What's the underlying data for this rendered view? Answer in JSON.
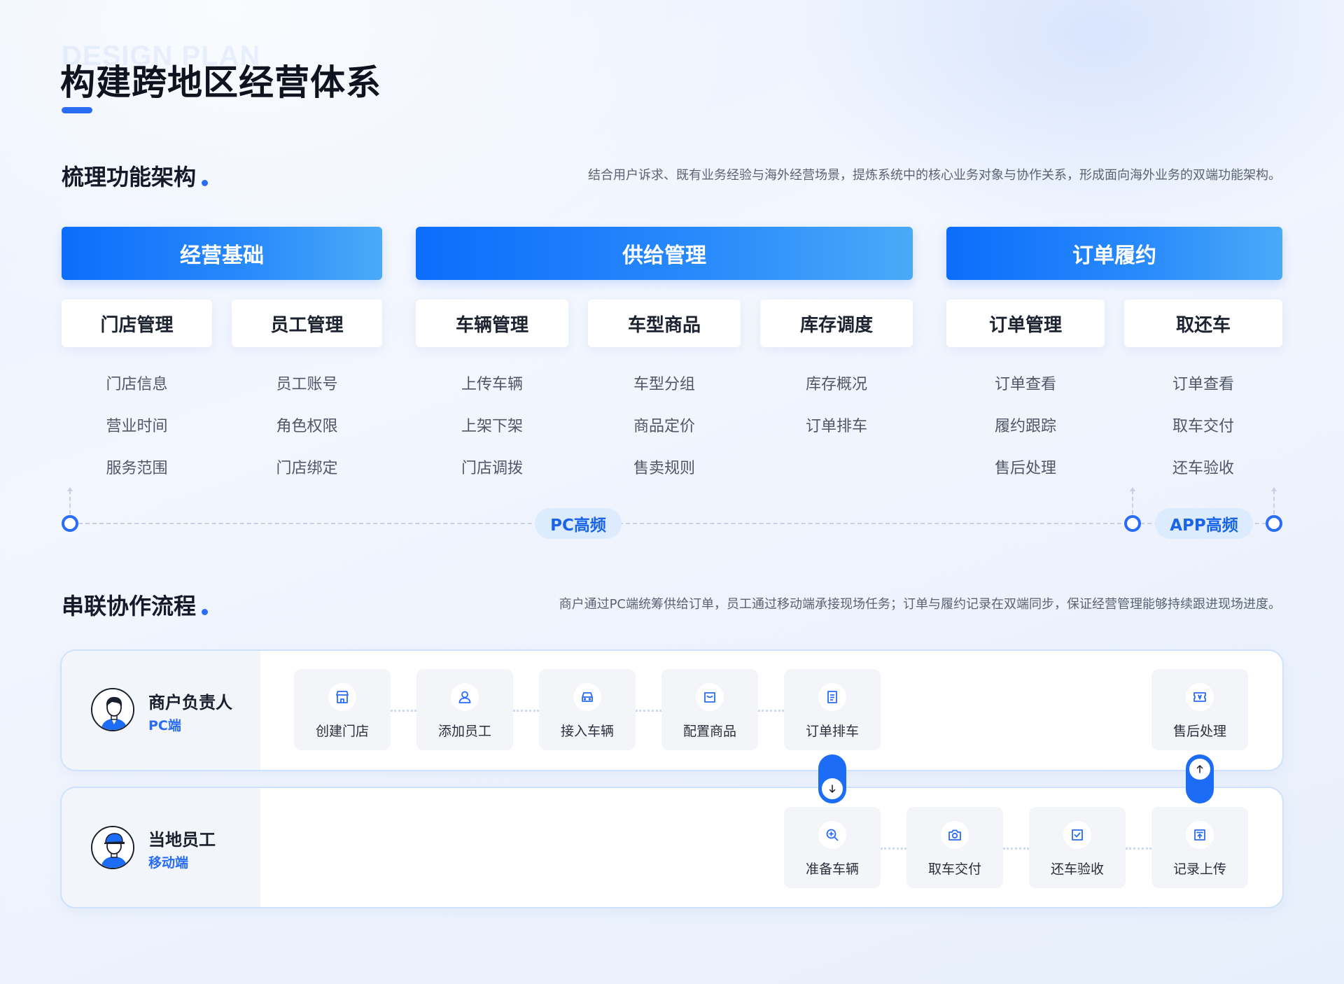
{
  "header": {
    "eyebrow": "DESIGN PLAN",
    "title": "构建跨地区经营体系"
  },
  "architecture": {
    "title": "梳理功能架构",
    "description": "结合用户诉求、既有业务经验与海外经营场景，提炼系统中的核心业务对象与协作关系，形成面向海外业务的双端功能架构。",
    "categories": [
      {
        "label": "经营基础",
        "modules": [
          {
            "label": "门店管理",
            "features": [
              "门店信息",
              "营业时间",
              "服务范围"
            ]
          },
          {
            "label": "员工管理",
            "features": [
              "员工账号",
              "角色权限",
              "门店绑定"
            ]
          }
        ]
      },
      {
        "label": "供给管理",
        "modules": [
          {
            "label": "车辆管理",
            "features": [
              "上传车辆",
              "上架下架",
              "门店调拨"
            ]
          },
          {
            "label": "车型商品",
            "features": [
              "车型分组",
              "商品定价",
              "售卖规则"
            ]
          },
          {
            "label": "库存调度",
            "features": [
              "库存概况",
              "订单排车"
            ]
          }
        ]
      },
      {
        "label": "订单履约",
        "modules": [
          {
            "label": "订单管理",
            "features": [
              "订单查看",
              "履约跟踪",
              "售后处理"
            ]
          },
          {
            "label": "取还车",
            "features": [
              "订单查看",
              "取车交付",
              "还车验收"
            ]
          }
        ]
      }
    ],
    "frequency": {
      "pc_label": "PC高频",
      "app_label": "APP高频"
    }
  },
  "flow": {
    "title": "串联协作流程",
    "description": "商户通过PC端统筹供给订单，员工通过移动端承接现场任务；订单与履约记录在双端同步，保证经营管理能够持续跟进现场进度。",
    "lanes": [
      {
        "role": "商户负责人",
        "platform": "PC端",
        "steps": [
          {
            "label": "创建门店",
            "icon": "store-icon"
          },
          {
            "label": "添加员工",
            "icon": "user-icon"
          },
          {
            "label": "接入车辆",
            "icon": "car-icon"
          },
          {
            "label": "配置商品",
            "icon": "bag-icon"
          },
          {
            "label": "订单排车",
            "icon": "document-icon"
          },
          {
            "label": "售后处理",
            "icon": "ticket-icon"
          }
        ]
      },
      {
        "role": "当地员工",
        "platform": "移动端",
        "steps": [
          {
            "label": "准备车辆",
            "icon": "zoom-in-icon"
          },
          {
            "label": "取车交付",
            "icon": "camera-icon"
          },
          {
            "label": "还车验收",
            "icon": "checkbox-icon"
          },
          {
            "label": "记录上传",
            "icon": "upload-icon"
          }
        ]
      }
    ]
  },
  "colors": {
    "primary": "#2a6cf5",
    "header_gradient_start": "#0b6dfb",
    "header_gradient_end": "#4aaaf8",
    "text": "#1a1f2e",
    "muted": "#5b6272"
  }
}
